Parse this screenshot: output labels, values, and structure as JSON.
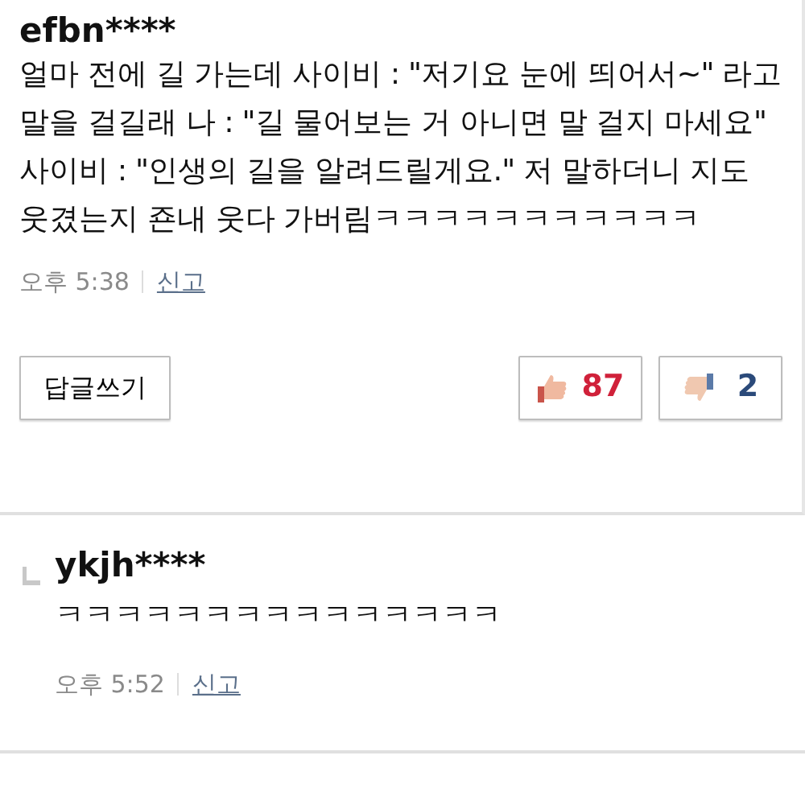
{
  "comment": {
    "author": "efbn****",
    "text": "얼마 전에 길 가는데 사이비 : \"저기요 눈에 띄어서~\" 라고 말을 걸길래 나 : \"길 물어보는 거 아니면 말 걸지 마세요\" 사이비 : \"인생의 길을 알려드릴게요.\" 저 말하더니 지도 웃겼는지 죤내 웃다 가버림ㅋㅋㅋㅋㅋㅋㅋㅋㅋㅋㅋ",
    "time": "오후 5:38",
    "report": "신고",
    "reply_button": "답글쓰기",
    "likes": "87",
    "dislikes": "2"
  },
  "replies": [
    {
      "author": "ykjh****",
      "text": "ㅋㅋㅋㅋㅋㅋㅋㅋㅋㅋㅋㅋㅋㅋㅋ",
      "time": "오후 5:52",
      "report": "신고"
    }
  ]
}
